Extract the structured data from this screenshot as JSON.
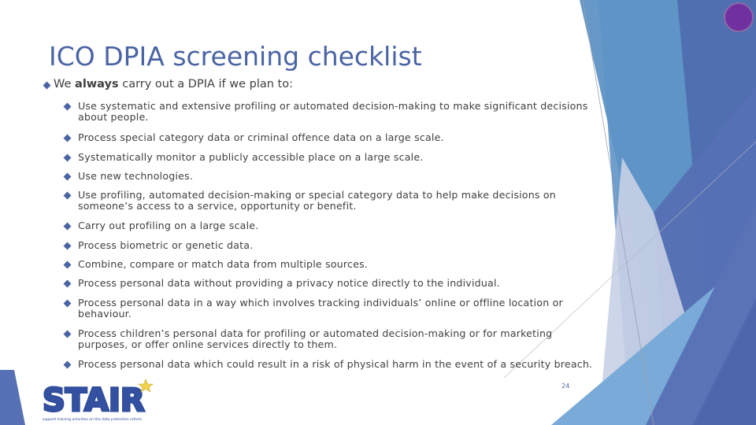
{
  "slide": {
    "title": "ICO DPIA screening checklist",
    "intro": {
      "prefix": "We ",
      "emphasis": "always",
      "suffix": " carry out a DPIA if we plan to:"
    },
    "items": [
      {
        "line1": "Use systematic and extensive profiling or automated decision-making to make significant decisions",
        "line2": "about people."
      },
      {
        "line1": "Process special category data or criminal offence data on a large scale.",
        "line2": ""
      },
      {
        "line1": "Systematically monitor a publicly accessible place on a large scale.",
        "line2": ""
      },
      {
        "line1": "Use new technologies.",
        "line2": ""
      },
      {
        "line1": "Use profiling, automated decision-making or special category data to help make decisions on",
        "line2": "someone’s access to a service, opportunity or benefit."
      },
      {
        "line1": "Carry out profiling on a large scale.",
        "line2": ""
      },
      {
        "line1": "Process biometric or genetic data.",
        "line2": ""
      },
      {
        "line1": "Combine, compare or match data from multiple sources.",
        "line2": ""
      },
      {
        "line1": "Process personal data without providing a privacy notice directly to the individual.",
        "line2": ""
      },
      {
        "line1": "Process personal data in a way which involves tracking individuals’ online or offline location or",
        "line2": "behaviour."
      },
      {
        "line1": "Process children’s personal data for profiling or automated decision-making or for marketing",
        "line2": "purposes, or offer online services directly to them."
      },
      {
        "line1": "Process personal data which could result in a risk of physical harm in the event of a security breach.",
        "line2": ""
      }
    ],
    "page_number": "24",
    "logo": {
      "text": "STAIR",
      "tagline": "support training activities on the data protection reform"
    },
    "bullet_icon": "diamond-bullet",
    "colors": {
      "accent": "#4a64a4",
      "body_text": "#404040",
      "circle": "#7030a0"
    }
  }
}
